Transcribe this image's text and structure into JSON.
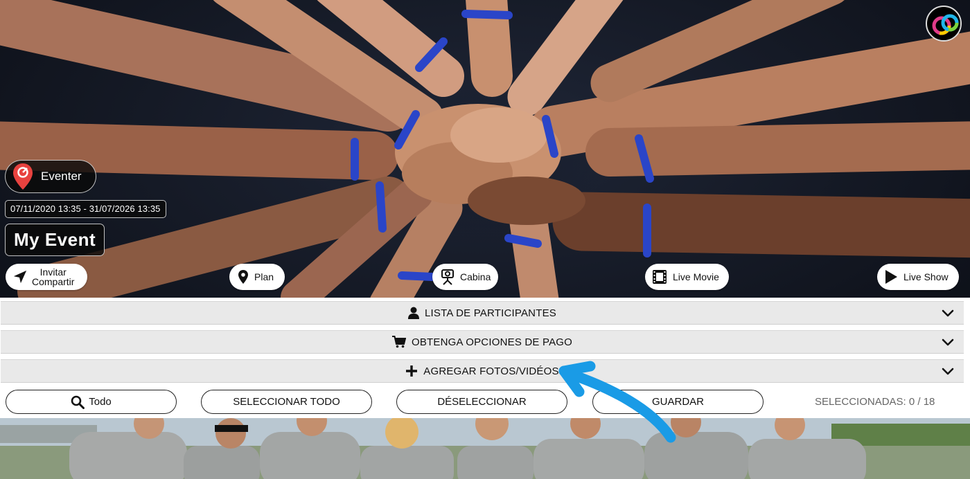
{
  "hero": {
    "brand_label": "Eventer",
    "date_range": "07/11/2020 13:35 - 31/07/2026 13:35",
    "event_title": "My Event",
    "buttons": {
      "invite_line1": "Invitar",
      "invite_line2": "Compartir",
      "plan": "Plan",
      "cabina": "Cabina",
      "live_movie": "Live Movie",
      "live_show": "Live Show"
    }
  },
  "sections": [
    {
      "label": "LISTA DE PARTICIPANTES",
      "icon": "user-icon"
    },
    {
      "label": "OBTENGA OPCIONES DE PAGO",
      "icon": "cart-icon"
    },
    {
      "label": "AGREGAR FOTOS/VIDÉOS",
      "icon": "plus-icon"
    }
  ],
  "toolbar": {
    "filter_label": "Todo",
    "select_all": "SELECCIONAR TODO",
    "deselect": "DÉSELECCIONAR",
    "save": "GUARDAR",
    "selected_count": "SELECCIONADAS: 0 / 18"
  },
  "colors": {
    "accent_blue": "#1a9be6",
    "pin_red": "#e8423f",
    "accordion_bg": "#e9e9e9"
  }
}
